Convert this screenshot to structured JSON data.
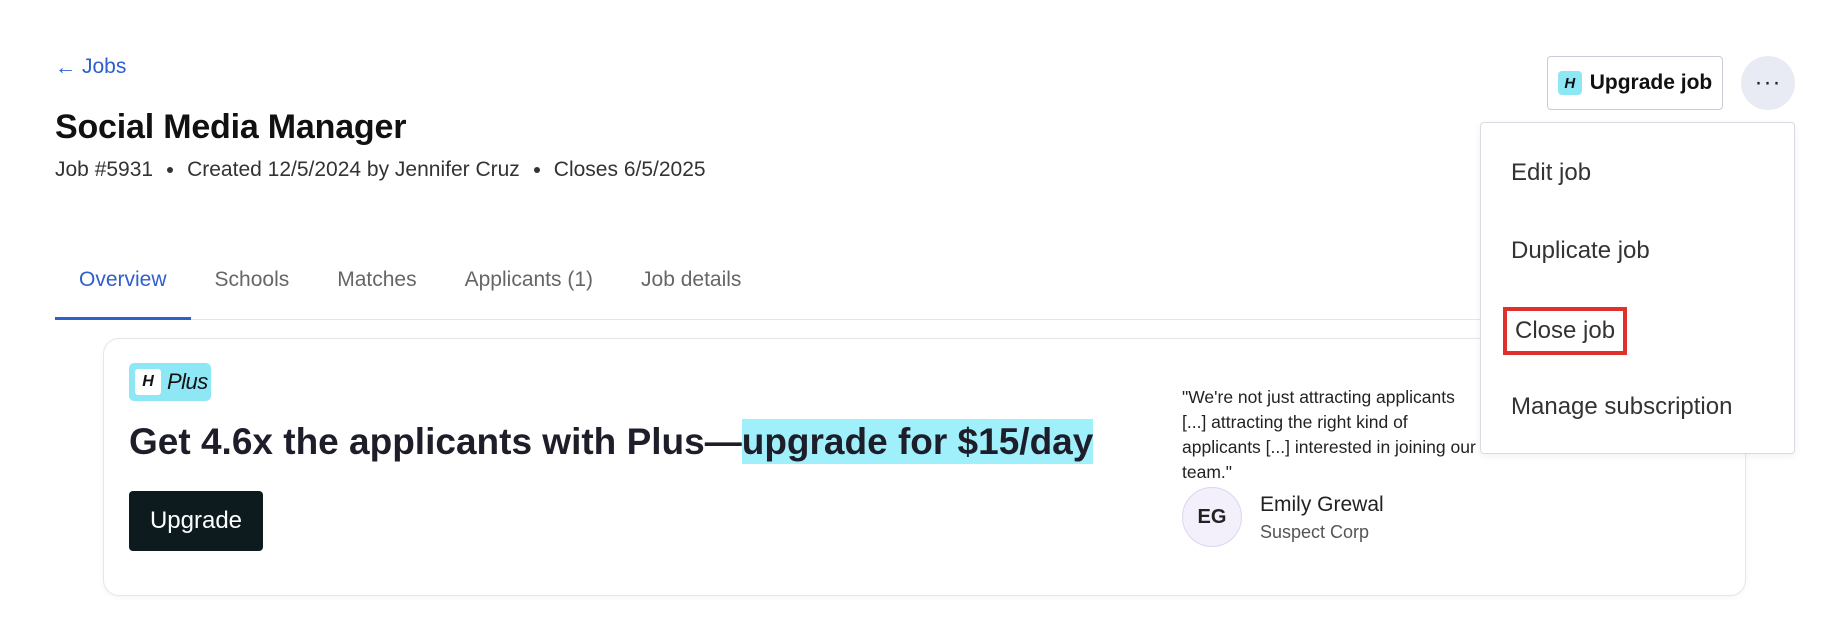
{
  "header": {
    "back_link": "Jobs",
    "title": "Social Media Manager",
    "meta": {
      "job_number": "Job #5931",
      "created": "Created 12/5/2024 by Jennifer Cruz",
      "closes": "Closes 6/5/2025"
    },
    "upgrade_job_label": "Upgrade job",
    "more_label": "···"
  },
  "menu": {
    "items": [
      {
        "label": "Edit job"
      },
      {
        "label": "Duplicate job"
      },
      {
        "label": "Close job"
      },
      {
        "label": "Manage subscription"
      }
    ]
  },
  "tabs": [
    {
      "label": "Overview",
      "active": true
    },
    {
      "label": "Schools",
      "active": false
    },
    {
      "label": "Matches",
      "active": false
    },
    {
      "label": "Applicants (1)",
      "active": false
    },
    {
      "label": "Job details",
      "active": false
    }
  ],
  "promo": {
    "badge_logo": "H",
    "badge_text": "Plus",
    "headline_prefix": "Get 4.6x the applicants with Plus—",
    "headline_highlight": "upgrade for $15/day",
    "button_label": "Upgrade",
    "highlight_color": "#9ff0fa",
    "testimonial": {
      "quote": "\"We're not just attracting applicants [...] attracting the right kind of applicants [...] interested in joining our team.\"",
      "initials": "EG",
      "name": "Emily Grewal",
      "company": "Suspect Corp"
    }
  },
  "colors": {
    "accent": "#2e5fcc",
    "highlight_box": "#e0302b",
    "brand_cyan": "#8ee7f5"
  },
  "icons": {
    "back": "arrow-left-icon",
    "more": "ellipsis-icon",
    "logo": "handshake-h-icon"
  }
}
